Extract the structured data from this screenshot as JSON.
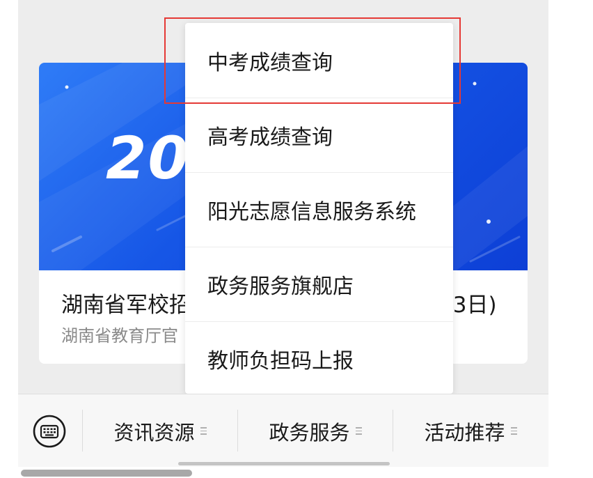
{
  "card": {
    "banner_text": "20",
    "title_start": "湖南省军校招",
    "title_end": "13日)",
    "source": "湖南省教育厅官"
  },
  "menu": {
    "items": [
      {
        "label": "中考成绩查询"
      },
      {
        "label": "高考成绩查询"
      },
      {
        "label": "阳光志愿信息服务系统"
      },
      {
        "label": "政务服务旗舰店"
      },
      {
        "label": "教师负担码上报"
      }
    ],
    "highlighted_index": 0,
    "highlight_color": "#e53935"
  },
  "tabbar": {
    "keyboard_icon": "keyboard-icon",
    "tabs": [
      {
        "label": "资讯资源",
        "icon": "menu-lines-icon"
      },
      {
        "label": "政务服务",
        "icon": "menu-lines-icon"
      },
      {
        "label": "活动推荐",
        "icon": "menu-lines-icon"
      }
    ]
  },
  "colors": {
    "banner_blue": "#1656e6",
    "background": "#ededed"
  }
}
